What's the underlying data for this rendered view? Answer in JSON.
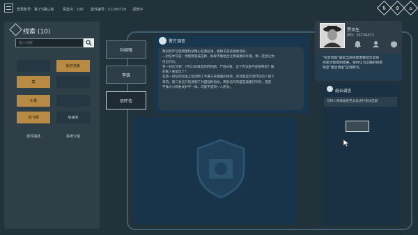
{
  "topbar": {
    "info": [
      {
        "label": "登录账号：",
        "value": "算了5路认真"
      },
      {
        "label": "探案点：",
        "value": "100"
      },
      {
        "label": "案件编号：",
        "value": "CC200729"
      },
      {
        "label": "调查中",
        "value": ""
      }
    ],
    "buttons": [
      "⇅",
      "⚙",
      "⌂"
    ]
  },
  "clues": {
    "title": "线索 (10)",
    "search_placeholder": "输入线索",
    "items": [
      "",
      "斯芬克斯",
      "案",
      "",
      "头笼",
      "",
      "张飞翔",
      "快递单",
      "案件描述",
      "系统介绍"
    ]
  },
  "characters": [
    "孙国强",
    "李骁",
    "恐吓信"
  ],
  "case": {
    "header": "警方调查",
    "lines": [
      "两封恐吓信使用塑料袋精心包裹起来，看样子是有意保存的。",
      "一封信中写道：你把我害成这样，如果不能给出让我满意的补偿，我一定会让你",
      "付出代价。",
      "另一封信写到：7月21日就是你的死期，尸首分离，这个死法是不是很熟悉？她",
      "的家人来复仇了！",
      "在第一封信的信纸上检测到了不属于孙国强的指纹，有可能是写恐吓信的人留下",
      "来的。第二封信只检测到了孙国强的指纹，两封信的内容是黑墨打印的，但是",
      "字体大小和格式并不一样，可能不是同一人所为。"
    ]
  },
  "character_card": {
    "name": "贾华生",
    "pid": "PID：23729471",
    "info_lines": [
      "\"组合调查\"是指当前线索需要结合其他",
      "线索才能得到结果。将你认为正确的线索",
      "拖至\"组合调查\"区域即可。"
    ]
  },
  "combo": {
    "title": "组合调查",
    "question": "可将人物线索拖至此处进行指纹匹配"
  },
  "colors": {
    "accent_gold": "#b98a43",
    "panel": "#2f3f48",
    "background": "#22323b"
  }
}
